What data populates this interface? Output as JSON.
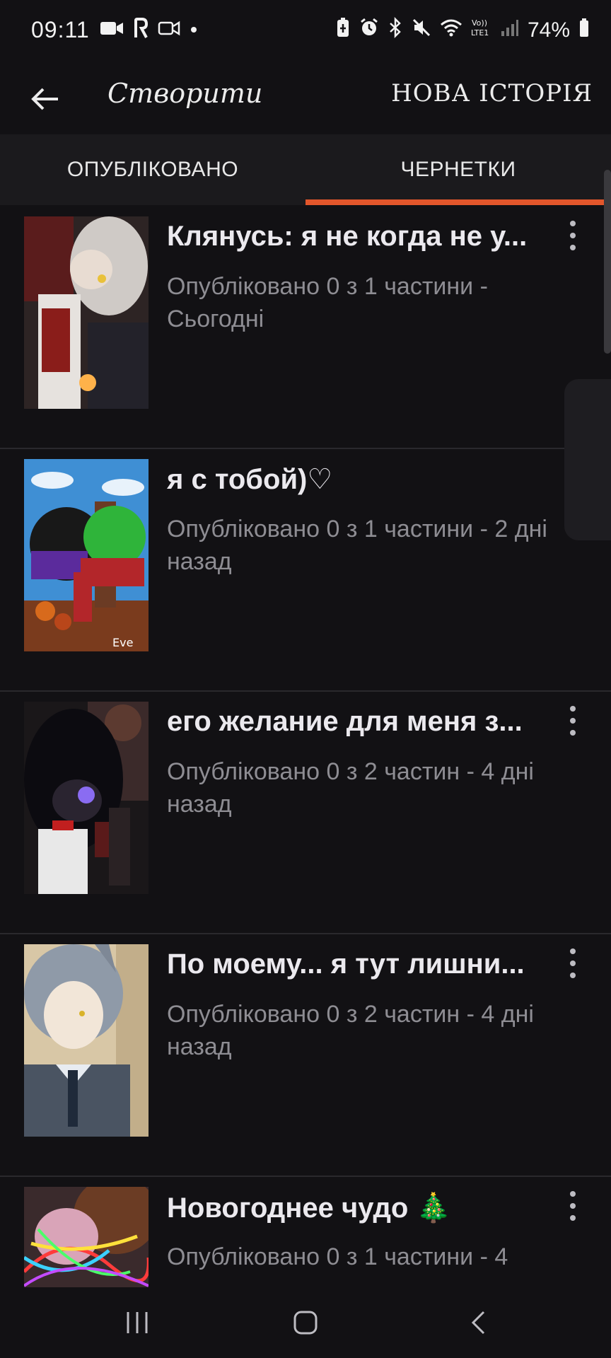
{
  "status_bar": {
    "time": "09:11",
    "battery": "74%"
  },
  "header": {
    "title": "Створити",
    "new_story": "НОВА ІСТОРІЯ"
  },
  "tabs": [
    {
      "label": "ОПУБЛІКОВАНО",
      "active": false
    },
    {
      "label": "ЧЕРНЕТКИ",
      "active": true
    }
  ],
  "accent_color": "#e2562b",
  "stories": [
    {
      "title": "Клянусь: я не когда не у...",
      "meta": "Опубліковано 0 з 1 частини - Сьогодні"
    },
    {
      "title": "я с тобой)♡",
      "meta": "Опубліковано 0 з 1 частини - 2 дні назад"
    },
    {
      "title": "его желание для меня з...",
      "meta": "Опубліковано 0 з 2 частин - 4 дні назад"
    },
    {
      "title": "По моему... я тут лишни...",
      "meta": "Опубліковано 0 з 2 частин - 4 дні назад"
    },
    {
      "title": "Новогоднее чудо 🎄",
      "meta": "Опубліковано 0 з 1 частини - 4"
    }
  ]
}
